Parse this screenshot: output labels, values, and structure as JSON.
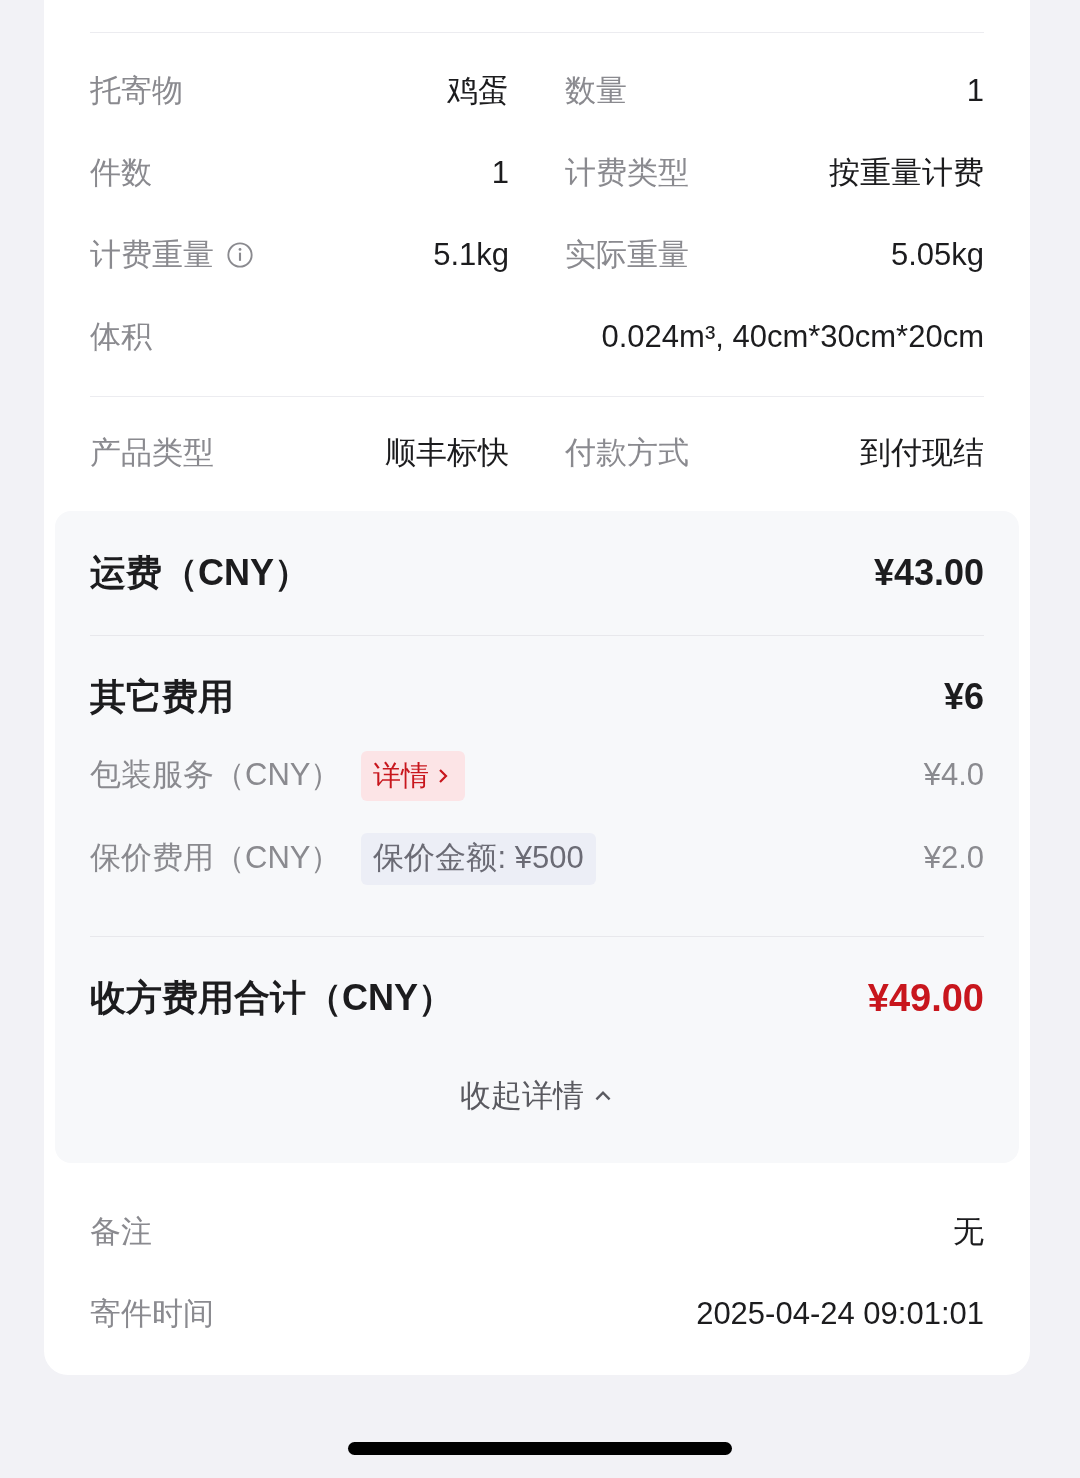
{
  "goods_rows": [
    {
      "cells": [
        {
          "label": "托寄物",
          "value": "鸡蛋",
          "has_info": false
        },
        {
          "label": "数量",
          "value": "1",
          "has_info": false
        }
      ]
    },
    {
      "cells": [
        {
          "label": "件数",
          "value": "1",
          "has_info": false
        },
        {
          "label": "计费类型",
          "value": "按重量计费",
          "has_info": false
        }
      ]
    },
    {
      "cells": [
        {
          "label": "计费重量",
          "value": "5.1kg",
          "has_info": true
        },
        {
          "label": "实际重量",
          "value": "5.05kg",
          "has_info": false
        }
      ]
    },
    {
      "cells": [
        {
          "label": "体积",
          "value": "0.024m³, 40cm*30cm*20cm",
          "has_info": false
        }
      ]
    }
  ],
  "service_row": {
    "cells": [
      {
        "label": "产品类型",
        "value": "顺丰标快",
        "has_info": false
      },
      {
        "label": "付款方式",
        "value": "到付现结",
        "has_info": false
      }
    ]
  },
  "freight": {
    "label": "运费（CNY）",
    "amount": "¥43.00"
  },
  "other_fees": {
    "title": "其它费用",
    "amount": "¥6",
    "items": [
      {
        "label": "包装服务（CNY）",
        "tag": {
          "kind": "link",
          "text": "详情"
        },
        "amount": "¥4.0"
      },
      {
        "label": "保价费用（CNY）",
        "tag": {
          "kind": "note",
          "text": "保价金额: ¥500"
        },
        "amount": "¥2.0"
      }
    ]
  },
  "total": {
    "label": "收方费用合计（CNY）",
    "amount": "¥49.00"
  },
  "collapse": {
    "text": "收起详情"
  },
  "extra_rows": [
    {
      "label": "备注",
      "value": "无"
    },
    {
      "label": "寄件时间",
      "value": "2025-04-24 09:01:01"
    }
  ]
}
